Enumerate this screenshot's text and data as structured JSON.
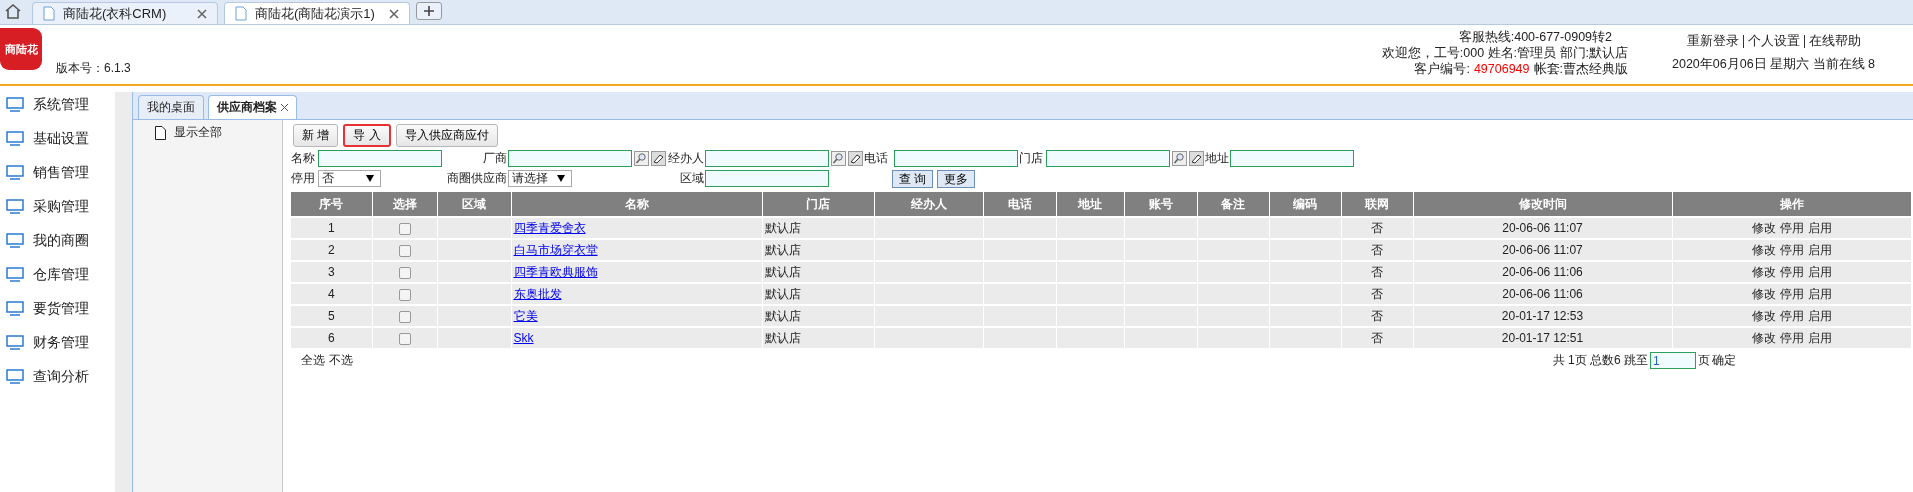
{
  "browser_tabs": [
    {
      "title": "商陆花(衣科CRM)",
      "selected": false
    },
    {
      "title": "商陆花(商陆花演示1)",
      "selected": true
    }
  ],
  "header": {
    "logo": "商陆花",
    "version": "版本号：6.1.3",
    "hotline": "客服热线:400-677-0909转2",
    "welcome": "欢迎您，工号:000 姓名:管理员 部门:默认店",
    "customer_label": "客户编号:",
    "customer_no": "49706949",
    "account": "帐套:曹杰经典版",
    "links": [
      "重新登录",
      "个人设置",
      "在线帮助"
    ],
    "date_line": "2020年06月06日 星期六 当前在线 8"
  },
  "sidebar": {
    "items": [
      "系统管理",
      "基础设置",
      "销售管理",
      "采购管理",
      "我的商圈",
      "仓库管理",
      "要货管理",
      "财务管理",
      "查询分析"
    ]
  },
  "tabs": [
    {
      "label": "我的桌面",
      "selected": false,
      "closable": false
    },
    {
      "label": "供应商档案",
      "selected": true,
      "closable": true
    }
  ],
  "tree": {
    "items": [
      "显示全部"
    ]
  },
  "toolbar": [
    {
      "label": "新 增",
      "highlighted": false
    },
    {
      "label": "导 入",
      "highlighted": true
    },
    {
      "label": "导入供应商应付",
      "highlighted": false
    }
  ],
  "filters": [
    [
      {
        "label": "名称",
        "kind": "text",
        "lookup": false
      },
      {
        "label": "厂商",
        "kind": "text",
        "lookup": true
      },
      {
        "label": "经办人",
        "kind": "text",
        "lookup": true
      },
      {
        "label": "电话",
        "kind": "text",
        "lookup": false
      },
      {
        "label": "门店",
        "kind": "text",
        "lookup": true
      },
      {
        "label": "地址",
        "kind": "text",
        "lookup": false
      }
    ],
    [
      {
        "label": "停用",
        "kind": "select",
        "value": "否"
      },
      {
        "label": "商圈供应商",
        "kind": "select",
        "value": "请选择"
      },
      {
        "label": "区域",
        "kind": "text",
        "lookup": false
      }
    ]
  ],
  "filter_buttons": [
    "查 询",
    "更多"
  ],
  "table": {
    "columns": [
      "序号",
      "选择",
      "区域",
      "名称",
      "门店",
      "经办人",
      "电话",
      "地址",
      "账号",
      "备注",
      "编码",
      "联网",
      "修改时间",
      "操作"
    ],
    "rows": [
      {
        "no": "1",
        "checked": false,
        "name": "四季青爱舍衣",
        "store": "默认店",
        "online": "否",
        "modified": "20-06-06 11:07",
        "actions": [
          "修改",
          "停用",
          "启用"
        ]
      },
      {
        "no": "2",
        "checked": false,
        "name": "白马市场穿衣堂",
        "store": "默认店",
        "online": "否",
        "modified": "20-06-06 11:07",
        "actions": [
          "修改",
          "停用",
          "启用"
        ]
      },
      {
        "no": "3",
        "checked": false,
        "name": "四季青欧典服饰",
        "store": "默认店",
        "online": "否",
        "modified": "20-06-06 11:06",
        "actions": [
          "修改",
          "停用",
          "启用"
        ]
      },
      {
        "no": "4",
        "checked": false,
        "name": "东奥批发",
        "store": "默认店",
        "online": "否",
        "modified": "20-06-06 11:06",
        "actions": [
          "修改",
          "停用",
          "启用"
        ]
      },
      {
        "no": "5",
        "checked": false,
        "name": "它美",
        "store": "默认店",
        "online": "否",
        "modified": "20-01-17 12:53",
        "actions": [
          "修改",
          "停用",
          "启用"
        ]
      },
      {
        "no": "6",
        "checked": false,
        "name": "Skk",
        "store": "默认店",
        "online": "否",
        "modified": "20-01-17 12:51",
        "actions": [
          "修改",
          "停用",
          "启用"
        ]
      }
    ]
  },
  "selection_links": [
    "全选",
    "不选"
  ],
  "pager": {
    "summary": "共 1页 总数6 跳至",
    "page": "1",
    "suffix": "页",
    "confirm": "确定"
  }
}
